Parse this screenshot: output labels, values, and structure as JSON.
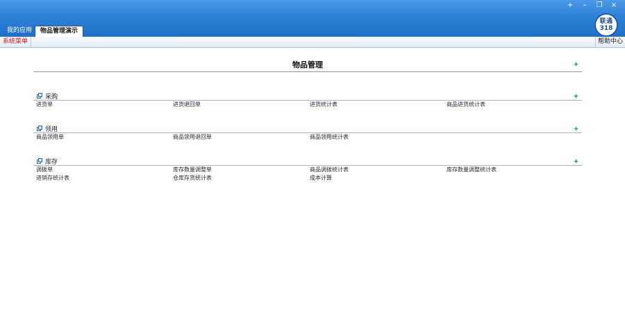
{
  "window_controls": [
    "+",
    "–",
    "❐",
    "×"
  ],
  "logo": {
    "line1": "联通",
    "line2": "318"
  },
  "tabs": [
    {
      "label": "我的应用"
    },
    {
      "label": "物品管理演示"
    }
  ],
  "menubar": {
    "left_label": "系统菜单",
    "right_label": "帮助中心"
  },
  "page_title": "物品管理",
  "sections": [
    {
      "title": "采购",
      "items": [
        "进货单",
        "进货退回单",
        "进货统计表",
        "商品进货统计表"
      ]
    },
    {
      "title": "领用",
      "items": [
        "商品领用单",
        "商品领用退回单",
        "商品领用统计表"
      ]
    },
    {
      "title": "库存",
      "items": [
        "调拨单",
        "库存数量调整单",
        "商品调拨统计表",
        "库存数量调整统计表",
        "进销存统计表",
        "仓库存货统计表",
        "成本计算"
      ]
    }
  ],
  "colors": {
    "titlebar": "#2f82d8",
    "accent_icon": "#2aa8a0",
    "menu_red": "#d01818"
  },
  "icons": {
    "section": "window-icon",
    "expand": "expand-diamond-icon"
  }
}
